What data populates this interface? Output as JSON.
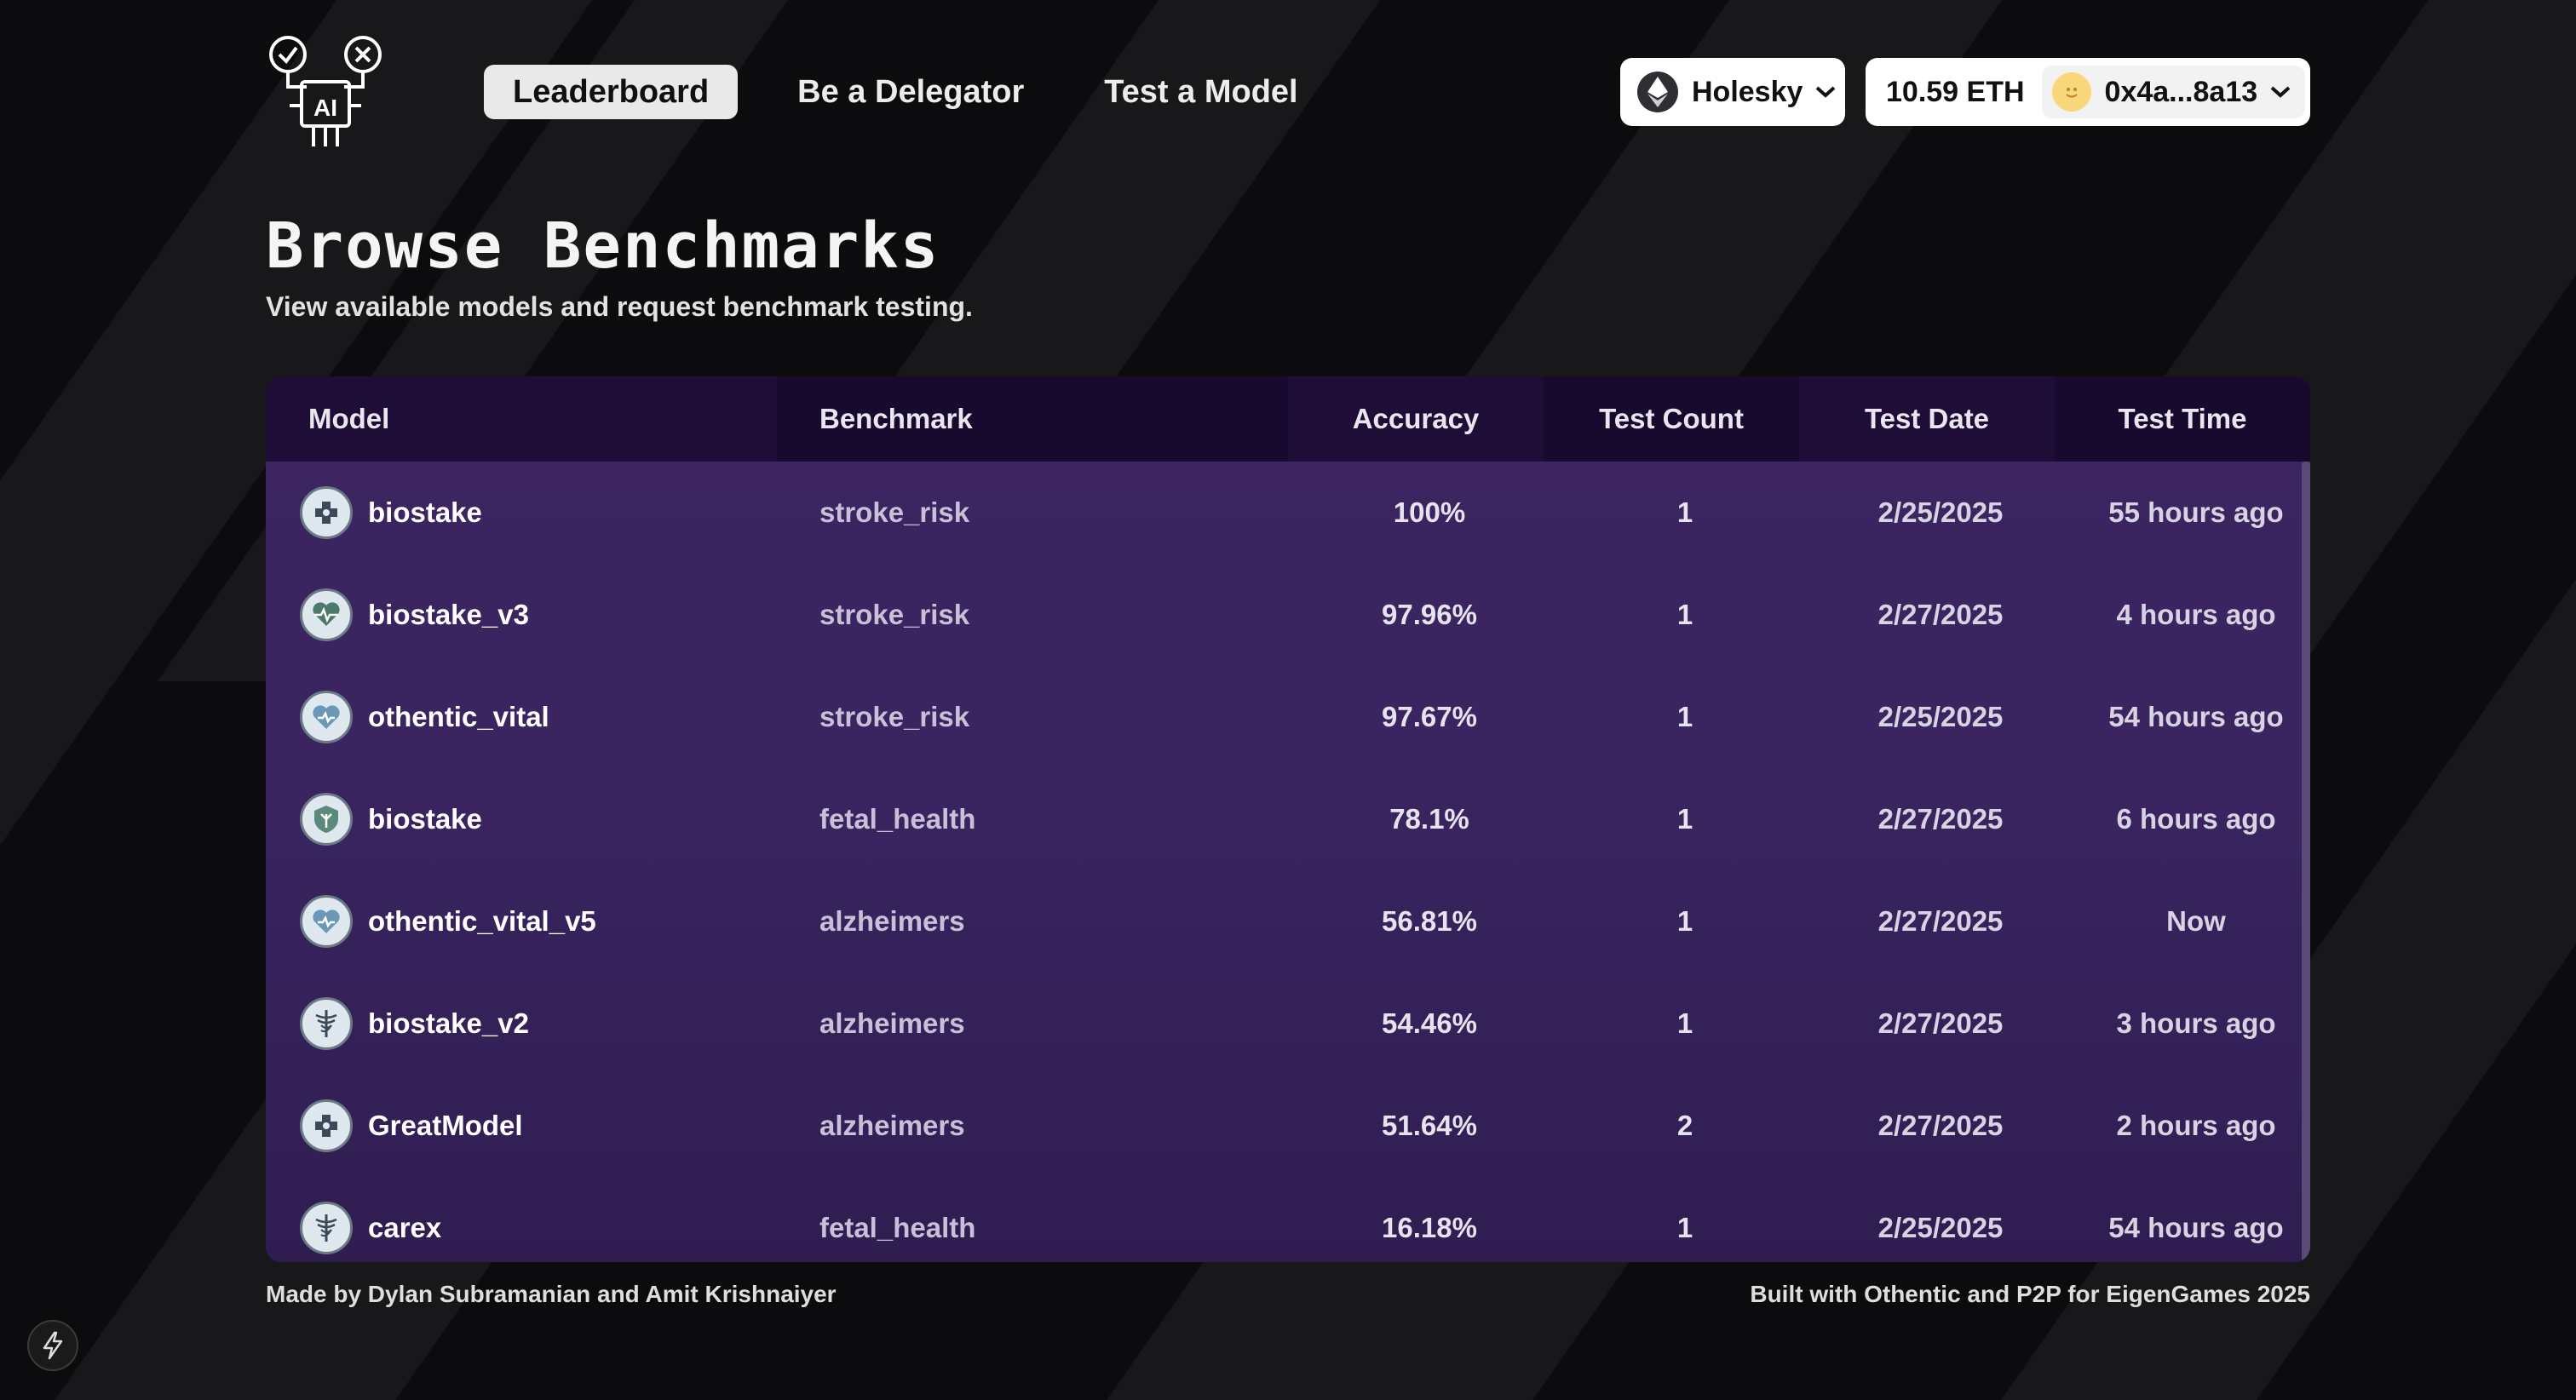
{
  "nav": {
    "items": [
      {
        "label": "Leaderboard",
        "active": true
      },
      {
        "label": "Be a Delegator",
        "active": false
      },
      {
        "label": "Test a Model",
        "active": false
      }
    ]
  },
  "network": {
    "label": "Holesky",
    "icon": "ethereum-icon"
  },
  "wallet": {
    "balance": "10.59 ETH",
    "address": "0x4a...8a13",
    "avatar": "smiley-avatar"
  },
  "page": {
    "title": "Browse Benchmarks",
    "subtitle": "View available models and request benchmark testing."
  },
  "table": {
    "columns": [
      "Model",
      "Benchmark",
      "Accuracy",
      "Test Count",
      "Test Date",
      "Test Time"
    ],
    "rows": [
      {
        "model": "biostake",
        "benchmark": "stroke_risk",
        "accuracy": "100%",
        "count": "1",
        "date": "2/25/2025",
        "time": "55 hours ago",
        "icon": "medical-cross-icon"
      },
      {
        "model": "biostake_v3",
        "benchmark": "stroke_risk",
        "accuracy": "97.96%",
        "count": "1",
        "date": "2/27/2025",
        "time": "4 hours ago",
        "icon": "heartbeat-icon"
      },
      {
        "model": "othentic_vital",
        "benchmark": "stroke_risk",
        "accuracy": "97.67%",
        "count": "1",
        "date": "2/25/2025",
        "time": "54 hours ago",
        "icon": "heart-icon"
      },
      {
        "model": "biostake",
        "benchmark": "fetal_health",
        "accuracy": "78.1%",
        "count": "1",
        "date": "2/27/2025",
        "time": "6 hours ago",
        "icon": "shield-leaf-icon"
      },
      {
        "model": "othentic_vital_v5",
        "benchmark": "alzheimers",
        "accuracy": "56.81%",
        "count": "1",
        "date": "2/27/2025",
        "time": "Now",
        "icon": "heart-icon"
      },
      {
        "model": "biostake_v2",
        "benchmark": "alzheimers",
        "accuracy": "54.46%",
        "count": "1",
        "date": "2/27/2025",
        "time": "3 hours ago",
        "icon": "caduceus-icon"
      },
      {
        "model": "GreatModel",
        "benchmark": "alzheimers",
        "accuracy": "51.64%",
        "count": "2",
        "date": "2/27/2025",
        "time": "2 hours ago",
        "icon": "medical-cross-icon"
      },
      {
        "model": "carex",
        "benchmark": "fetal_health",
        "accuracy": "16.18%",
        "count": "1",
        "date": "2/25/2025",
        "time": "54 hours ago",
        "icon": "caduceus-icon"
      }
    ]
  },
  "footer": {
    "left": "Made by Dylan Subramanian and Amit Krishnaiyer",
    "right": "Built with Othentic and P2P for EigenGames 2025"
  },
  "colors": {
    "background": "#0c0c0e",
    "table_header": "#1b0c33",
    "table_body": "#3a2560"
  }
}
